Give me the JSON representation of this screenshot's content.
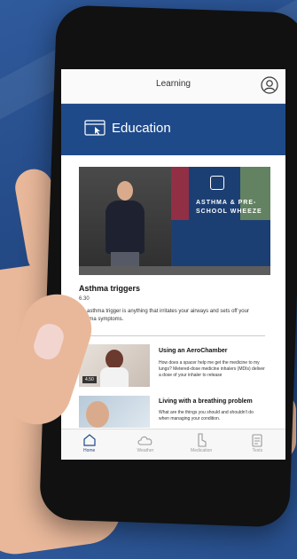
{
  "header": {
    "title": "Learning",
    "profile_icon": "user-circle-icon"
  },
  "banner": {
    "title": "Education",
    "icon": "monitor-cursor-icon",
    "color": "#1f4a8a"
  },
  "featured": {
    "slide_title": "ASTHMA & PRE-SCHOOL WHEEZE",
    "title": "Asthma triggers",
    "duration": "6.30",
    "description": "An asthma trigger is anything that irritates your airways and sets off your asthma symptoms."
  },
  "videos": [
    {
      "title": "Using an AeroChamber",
      "description": "How does a spacer help me get the medicine to my lungs? Metered-dose medicine inhalers (MDIs) deliver a dose of your inhaler to release",
      "duration": "4.50"
    },
    {
      "title": "Living with a breathing problem",
      "description": "What are the things you should and shouldn't do when managing your condition."
    }
  ],
  "tabs": [
    {
      "label": "Home",
      "icon": "home-icon",
      "active": true
    },
    {
      "label": "Weather",
      "icon": "cloud-icon",
      "active": false
    },
    {
      "label": "Medication",
      "icon": "inhaler-icon",
      "active": false
    },
    {
      "label": "Tests",
      "icon": "clipboard-icon",
      "active": false
    }
  ]
}
